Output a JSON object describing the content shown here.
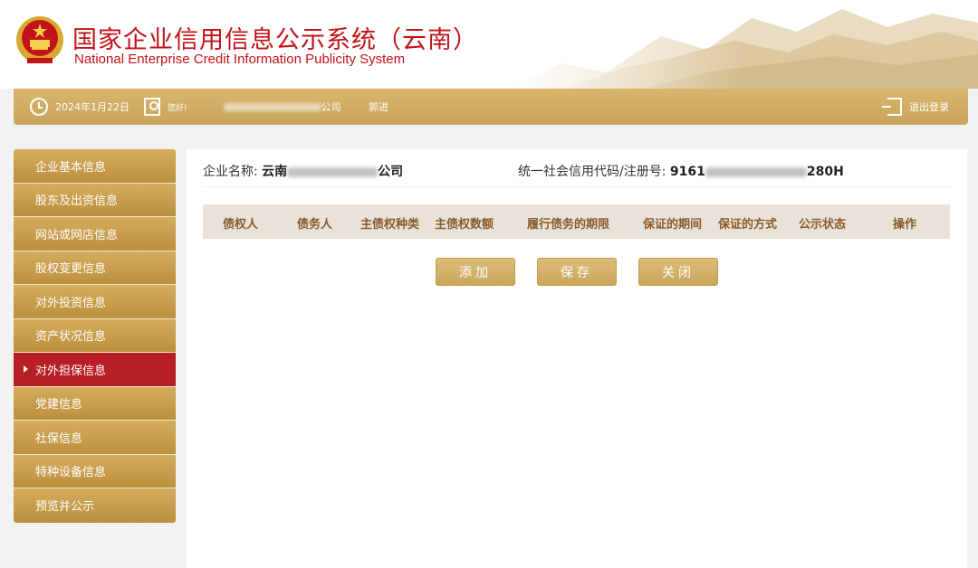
{
  "header": {
    "title_cn": "国家企业信用信息公示系统（云南）",
    "title_en": "National Enterprise Credit Information Publicity System"
  },
  "topbar": {
    "date": "2024年1月22日",
    "greeting": "您好!",
    "company_suffix": "公司",
    "action": "郭进",
    "logout": "退出登录"
  },
  "sidebar": {
    "items": [
      {
        "label": "企业基本信息",
        "active": false
      },
      {
        "label": "股东及出资信息",
        "active": false
      },
      {
        "label": "网站或网店信息",
        "active": false
      },
      {
        "label": "股权变更信息",
        "active": false
      },
      {
        "label": "对外投资信息",
        "active": false
      },
      {
        "label": "资产状况信息",
        "active": false
      },
      {
        "label": "对外担保信息",
        "active": true
      },
      {
        "label": "党建信息",
        "active": false
      },
      {
        "label": "社保信息",
        "active": false
      },
      {
        "label": "特种设备信息",
        "active": false
      },
      {
        "label": "预览并公示",
        "active": false
      }
    ]
  },
  "main": {
    "company_label": "企业名称:",
    "company_prefix": "云南",
    "company_suffix": "公司",
    "code_label": "统一社会信用代码/注册号:",
    "code_prefix": "9161",
    "code_suffix": "280H",
    "columns": [
      "债权人",
      "债务人",
      "主债权种类",
      "主债权数额",
      "履行债务的期限",
      "保证的期间",
      "保证的方式",
      "公示状态",
      "操作"
    ],
    "buttons": {
      "add": "添加",
      "save": "保存",
      "close": "关闭"
    }
  },
  "colors": {
    "accent": "#c9a55b",
    "active": "#b81f24",
    "title": "#c2121a"
  }
}
